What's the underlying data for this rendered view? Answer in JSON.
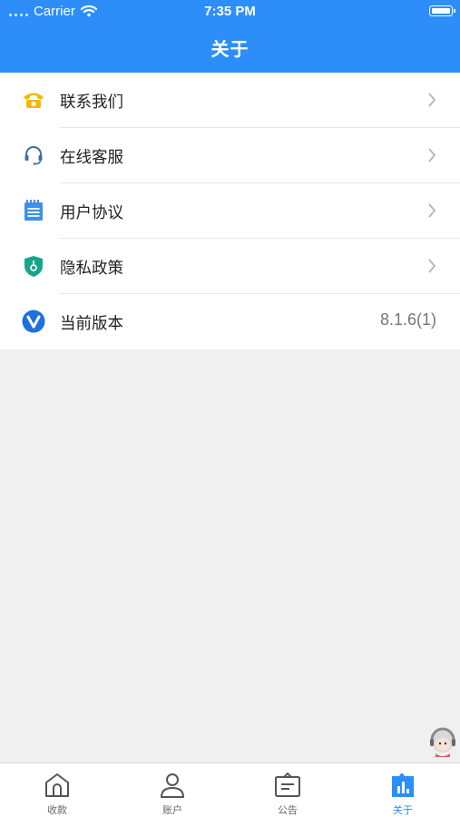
{
  "status_bar": {
    "carrier": "Carrier",
    "time": "7:35 PM"
  },
  "nav": {
    "title": "关于"
  },
  "menu": [
    {
      "label": "联系我们",
      "icon": "phone-icon",
      "color": "#f5b800"
    },
    {
      "label": "在线客服",
      "icon": "headset-icon",
      "color": "#3a6ea5"
    },
    {
      "label": "用户协议",
      "icon": "notepad-icon",
      "color": "#3e8fe6"
    },
    {
      "label": "隐私政策",
      "icon": "shield-icon",
      "color": "#17a589"
    },
    {
      "label": "当前版本",
      "icon": "version-icon",
      "color": "#1e6fe0",
      "value": "8.1.6(1)"
    }
  ],
  "tabs": [
    {
      "label": "收款",
      "icon": "home-icon"
    },
    {
      "label": "账户",
      "icon": "user-icon"
    },
    {
      "label": "公告",
      "icon": "notice-board-icon"
    },
    {
      "label": "关于",
      "icon": "bar-chart-icon",
      "active": true
    }
  ],
  "colors": {
    "accent": "#2d8ef9",
    "background": "#f0f0f0"
  }
}
